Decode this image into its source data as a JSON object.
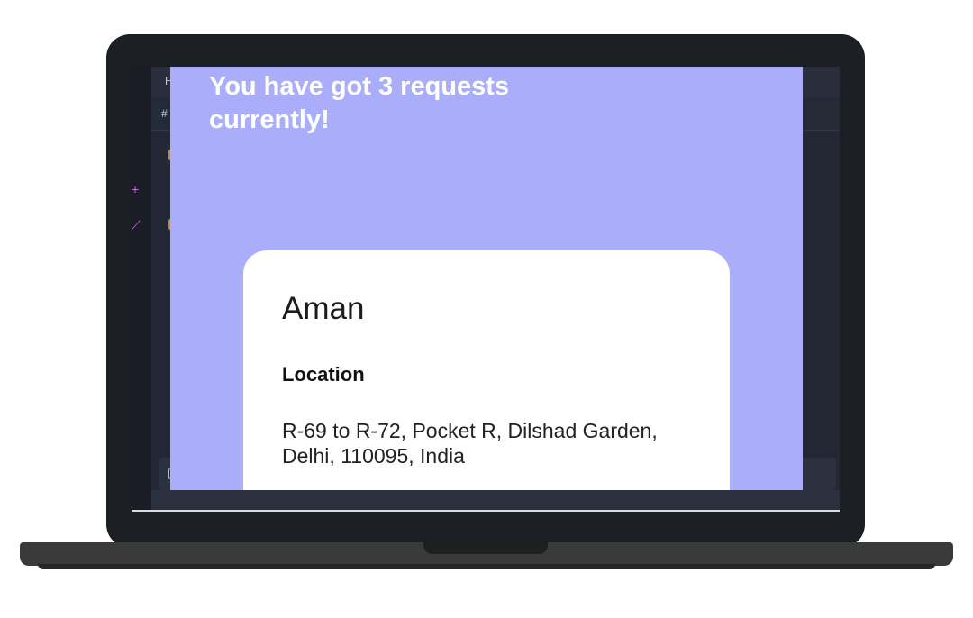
{
  "app": {
    "headline": "You have got 3 requests currently!",
    "request_card": {
      "name": "Aman",
      "location_label": "Location",
      "location_text": "R-69 to R-72, Pocket R, Dilshad Garden, Delhi, 110095, India"
    }
  },
  "background_app": {
    "topbar_glyph": "H",
    "channel_glyph": "#",
    "input_glyph": "["
  },
  "colors": {
    "app_background": "#aaadf9",
    "card_background": "#ffffff",
    "laptop_frame": "#1b1f24"
  }
}
